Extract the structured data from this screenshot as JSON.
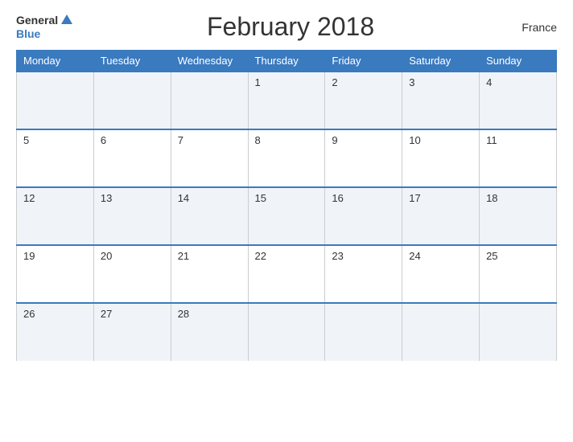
{
  "header": {
    "logo_general": "General",
    "logo_blue": "Blue",
    "title": "February 2018",
    "country": "France"
  },
  "days_of_week": [
    "Monday",
    "Tuesday",
    "Wednesday",
    "Thursday",
    "Friday",
    "Saturday",
    "Sunday"
  ],
  "weeks": [
    [
      "",
      "",
      "",
      "1",
      "2",
      "3",
      "4"
    ],
    [
      "5",
      "6",
      "7",
      "8",
      "9",
      "10",
      "11"
    ],
    [
      "12",
      "13",
      "14",
      "15",
      "16",
      "17",
      "18"
    ],
    [
      "19",
      "20",
      "21",
      "22",
      "23",
      "24",
      "25"
    ],
    [
      "26",
      "27",
      "28",
      "",
      "",
      "",
      ""
    ]
  ]
}
